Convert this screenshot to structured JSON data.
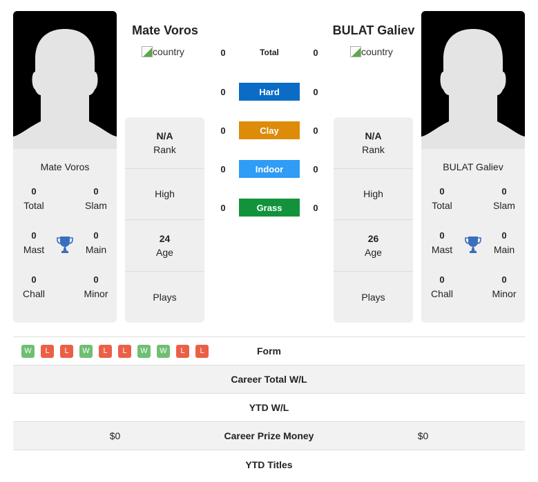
{
  "player1": {
    "name": "Mate Voros",
    "country_alt": "country",
    "card_name": "Mate Voros",
    "titles": {
      "total": {
        "value": "0",
        "label": "Total"
      },
      "slam": {
        "value": "0",
        "label": "Slam"
      },
      "mast": {
        "value": "0",
        "label": "Mast"
      },
      "main": {
        "value": "0",
        "label": "Main"
      },
      "chall": {
        "value": "0",
        "label": "Chall"
      },
      "minor": {
        "value": "0",
        "label": "Minor"
      }
    },
    "info": {
      "rank_value": "N/A",
      "rank_label": "Rank",
      "high_label": "High",
      "age_value": "24",
      "age_label": "Age",
      "plays_label": "Plays"
    },
    "form": [
      "W",
      "L",
      "L",
      "W",
      "L",
      "L",
      "W",
      "W",
      "L",
      "L"
    ],
    "career_prize_money": "$0"
  },
  "player2": {
    "name": "BULAT Galiev",
    "country_alt": "country",
    "card_name": "BULAT Galiev",
    "titles": {
      "total": {
        "value": "0",
        "label": "Total"
      },
      "slam": {
        "value": "0",
        "label": "Slam"
      },
      "mast": {
        "value": "0",
        "label": "Mast"
      },
      "main": {
        "value": "0",
        "label": "Main"
      },
      "chall": {
        "value": "0",
        "label": "Chall"
      },
      "minor": {
        "value": "0",
        "label": "Minor"
      }
    },
    "info": {
      "rank_value": "N/A",
      "rank_label": "Rank",
      "high_label": "High",
      "age_value": "26",
      "age_label": "Age",
      "plays_label": "Plays"
    },
    "career_prize_money": "$0"
  },
  "surfaces": [
    {
      "label": "Total",
      "p1": "0",
      "p2": "0",
      "color": ""
    },
    {
      "label": "Hard",
      "p1": "0",
      "p2": "0",
      "color": "#0a6cc4"
    },
    {
      "label": "Clay",
      "p1": "0",
      "p2": "0",
      "color": "#de8b0a"
    },
    {
      "label": "Indoor",
      "p1": "0",
      "p2": "0",
      "color": "#2f9cf5"
    },
    {
      "label": "Grass",
      "p1": "0",
      "p2": "0",
      "color": "#12933b"
    }
  ],
  "table": {
    "form_label": "Form",
    "career_wl_label": "Career Total W/L",
    "ytd_wl_label": "YTD W/L",
    "prize_label": "Career Prize Money",
    "ytd_titles_label": "YTD Titles"
  }
}
